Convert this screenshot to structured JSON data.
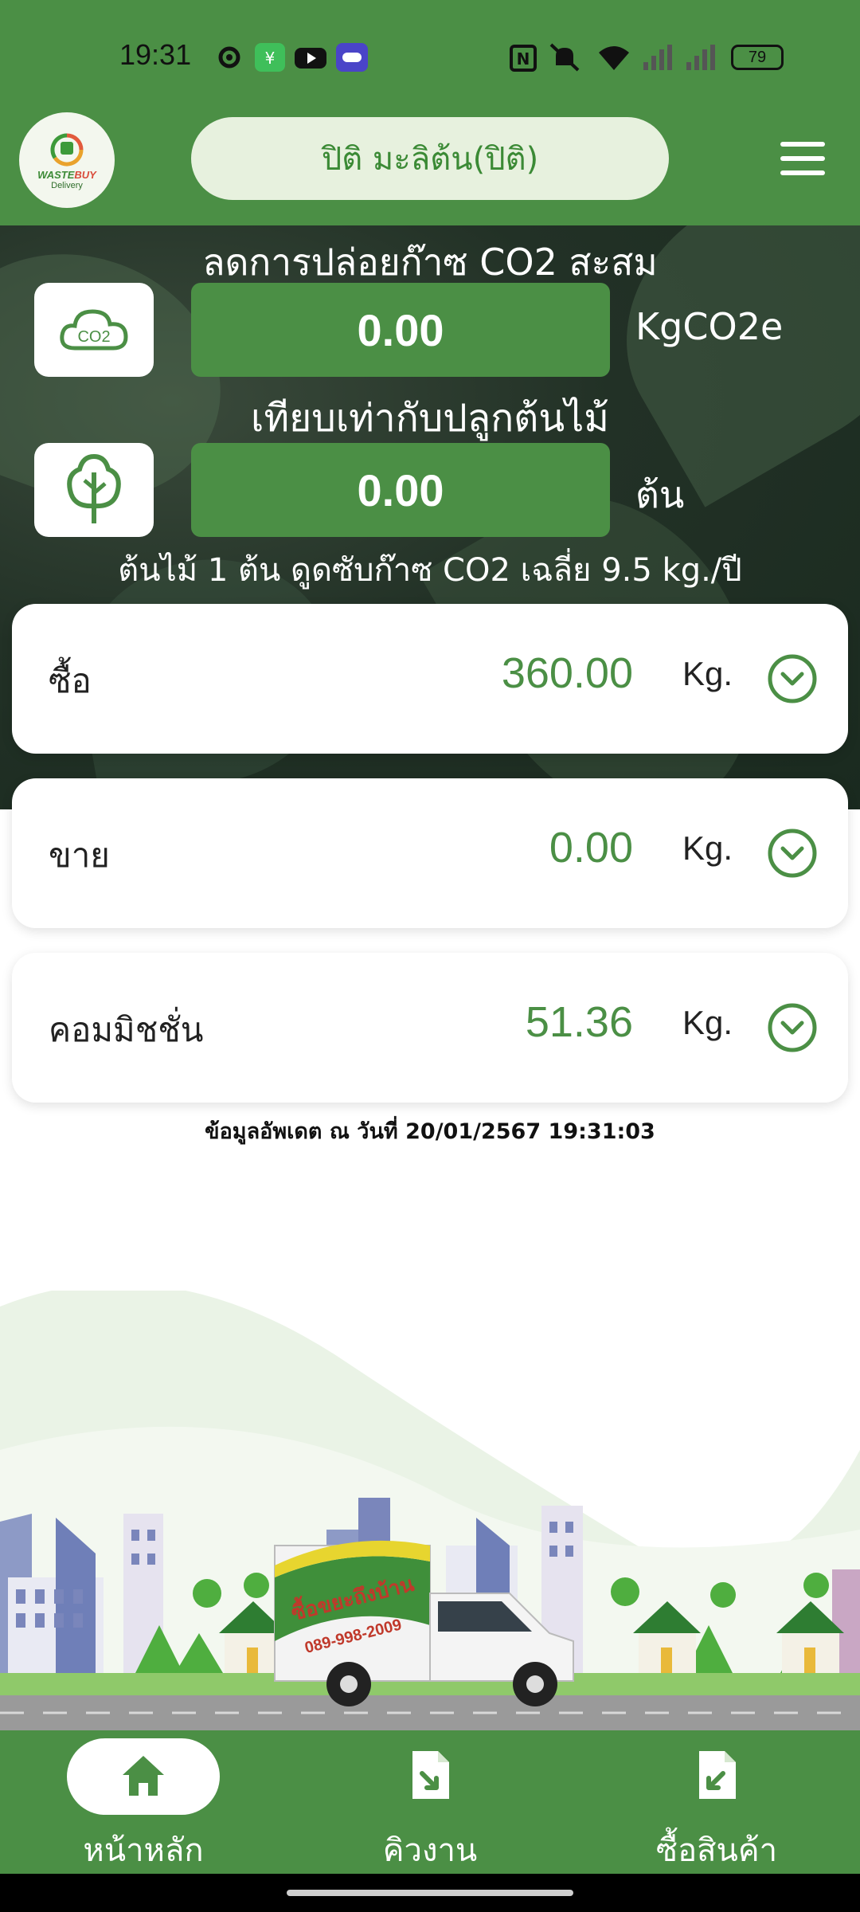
{
  "status_bar": {
    "time": "19:31",
    "battery": "79",
    "icons": [
      "settings-icon",
      "app-icon",
      "youtube-icon",
      "game-icon",
      "nfc-icon",
      "mute-icon",
      "wifi-icon",
      "signal-icon",
      "battery-icon"
    ]
  },
  "header": {
    "logo_text_1": "WASTE",
    "logo_text_1b": "BUY",
    "logo_text_2": "Delivery",
    "user_name": "ปิติ มะลิต้น(ปิติ)",
    "menu_icon": "hamburger-icon"
  },
  "hero": {
    "co2_title": "ลดการปล่อยก๊าซ CO2 สะสม",
    "co2_value": "0.00",
    "co2_unit": "KgCO2e",
    "co2_icon_label": "CO2",
    "tree_title": "เทียบเท่ากับปลูกต้นไม้",
    "tree_value": "0.00",
    "tree_unit": "ต้น",
    "note": "ต้นไม้ 1 ต้น ดูดซับก๊าซ CO2 เฉลี่ย 9.5 kg./ปี"
  },
  "cards": [
    {
      "label": "ซื้อ",
      "value": "360.00",
      "unit": "Kg."
    },
    {
      "label": "ขาย",
      "value": "0.00",
      "unit": "Kg."
    },
    {
      "label": "คอมมิชชั่น",
      "value": "51.36",
      "unit": "Kg."
    }
  ],
  "updated_text": "ข้อมูลอัพเดต ณ วันที่ 20/01/2567 19:31:03",
  "illustration": {
    "truck_sign": "ซื้อขยะถึงบ้าน",
    "truck_phone": "089-998-2009"
  },
  "bottom_nav": [
    {
      "label": "หน้าหลัก",
      "icon": "home-icon",
      "active": true
    },
    {
      "label": "คิวงาน",
      "icon": "queue-document-icon",
      "active": false
    },
    {
      "label": "ซื้อสินค้า",
      "icon": "buy-document-icon",
      "active": false
    }
  ],
  "colors": {
    "brand_green": "#4b8f45",
    "pill_bg": "#e7f1de",
    "hero_dark": "#223126"
  }
}
